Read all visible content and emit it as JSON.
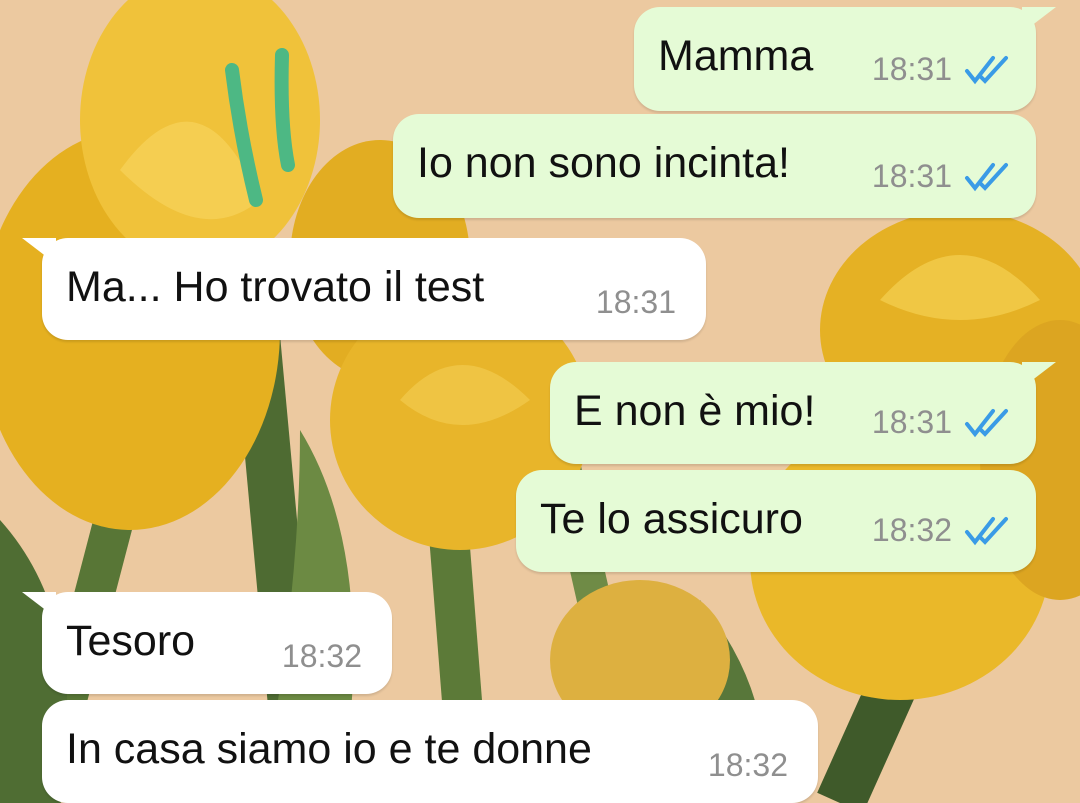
{
  "conversation": {
    "messages": [
      {
        "direction": "out",
        "text": "Mamma",
        "time": "18:31",
        "read_ticks_color": "#3a9be6"
      },
      {
        "direction": "out",
        "text": "Io non sono incinta!",
        "time": "18:31",
        "read_ticks_color": "#3a9be6"
      },
      {
        "direction": "in",
        "text": "Ma... Ho trovato il test",
        "time": "18:31"
      },
      {
        "direction": "out",
        "text": "E non è mio!",
        "time": "18:31",
        "read_ticks_color": "#3a9be6"
      },
      {
        "direction": "out",
        "text": "Te lo assicuro",
        "time": "18:32",
        "read_ticks_color": "#3a9be6"
      },
      {
        "direction": "in",
        "text": "Tesoro",
        "time": "18:32"
      },
      {
        "direction": "in",
        "text": "In casa siamo io e te donne",
        "time": "18:32"
      }
    ]
  },
  "theme": {
    "outgoing_bubble": "#e5fbd6",
    "incoming_bubble": "#ffffff",
    "wallpaper_subject": "yellow tulips",
    "scribble_color": "#4db884"
  }
}
